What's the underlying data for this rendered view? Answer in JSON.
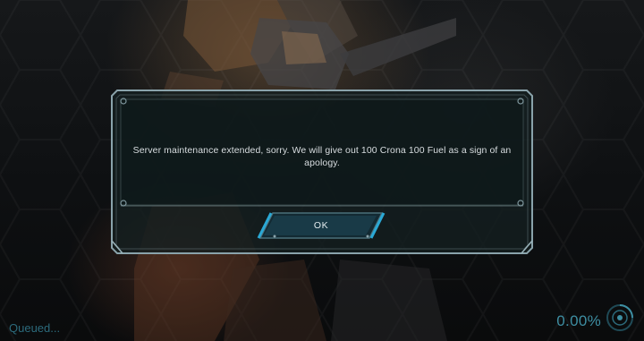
{
  "dialog": {
    "message": "Server maintenance extended, sorry. We will give out 100 Crona 100 Fuel as a sign of an apology.",
    "ok_label": "OK"
  },
  "status": {
    "text": "Queued...",
    "progress": "0.00%"
  },
  "icons": {
    "loader": "spinner-icon"
  },
  "colors": {
    "accent": "#2aa9d6",
    "frame": "#6f8790",
    "status_text": "#2c6b7c",
    "progress_text": "#3e8fa3"
  }
}
